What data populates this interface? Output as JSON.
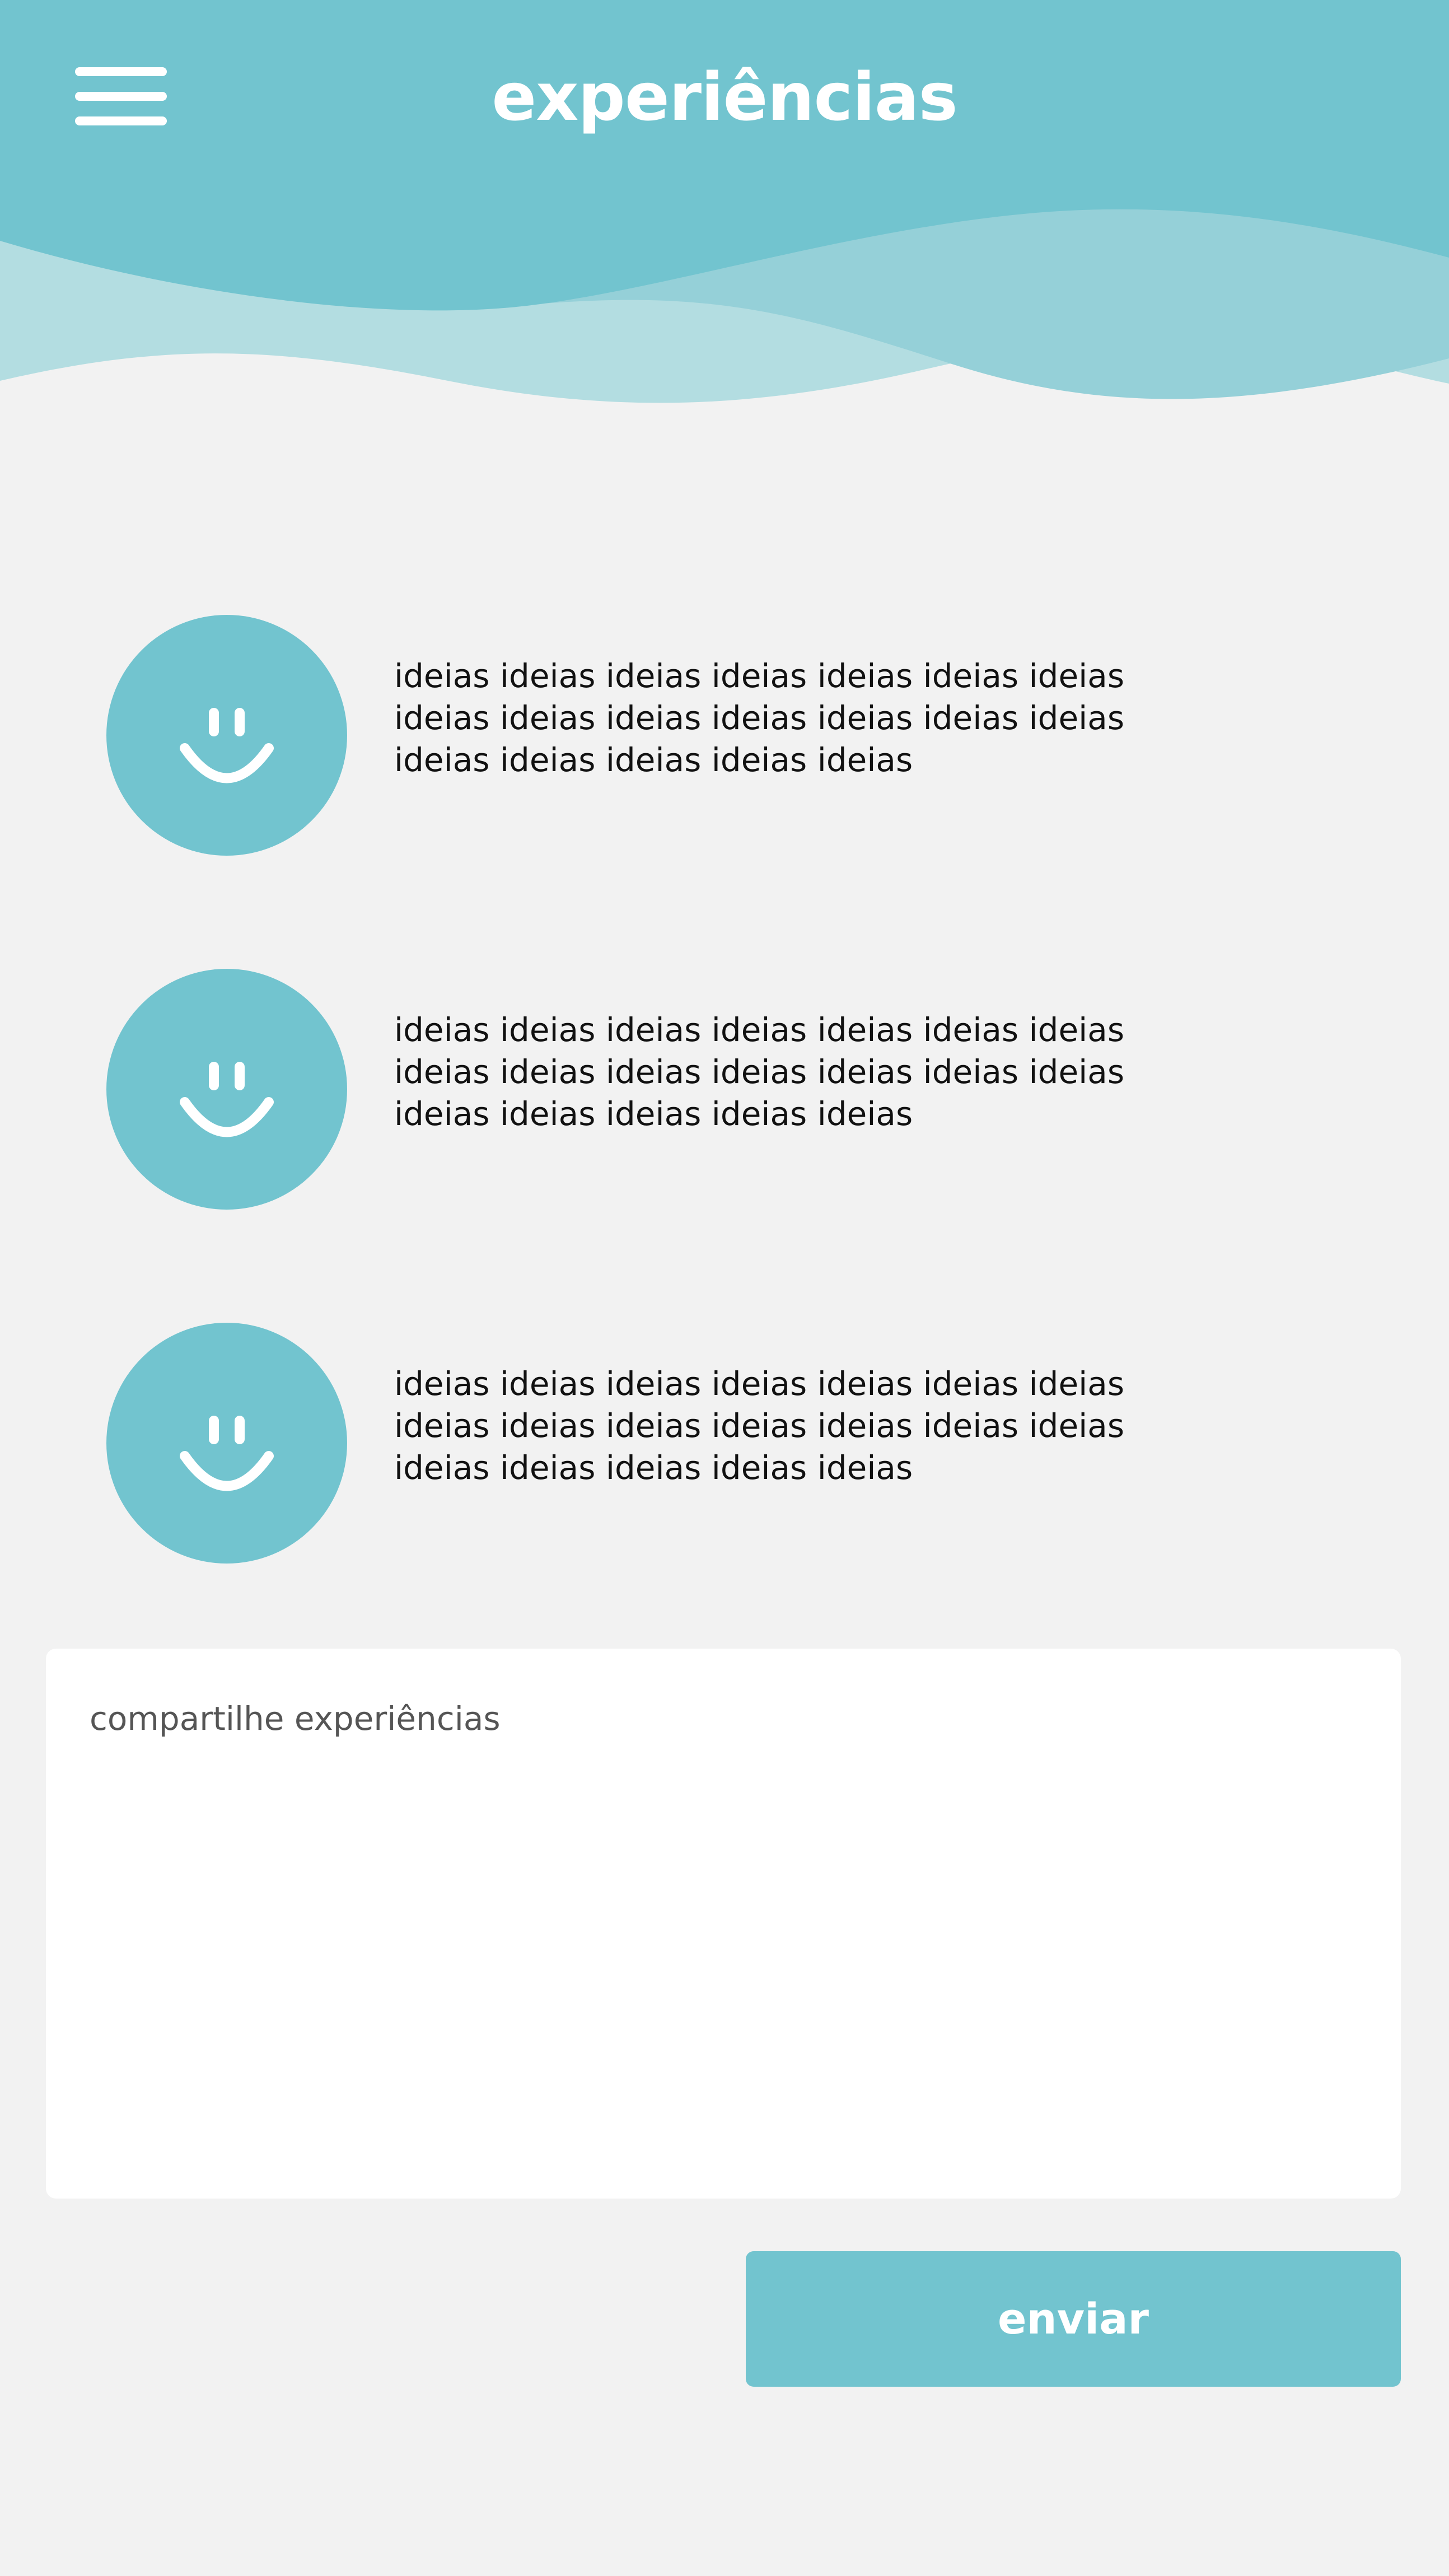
{
  "header": {
    "title": "experiências",
    "menu_icon": "hamburger-menu-icon",
    "colors": {
      "primary": "#72c4cf",
      "wave_mid": "#95d0d8",
      "wave_light": "#b3dde1"
    }
  },
  "feed": {
    "items": [
      {
        "avatar_icon": "smiley-face-icon",
        "text": "ideias ideias ideias ideias ideias ideias ideias ideias ideias ideias ideias ideias ideias ideias ideias ideias ideias ideias ideias"
      },
      {
        "avatar_icon": "smiley-face-icon",
        "text": "ideias ideias ideias ideias ideias ideias ideias ideias ideias ideias ideias ideias ideias ideias ideias ideias ideias ideias ideias"
      },
      {
        "avatar_icon": "smiley-face-icon",
        "text": "ideias ideias ideias ideias ideias ideias ideias ideias ideias ideias ideias ideias ideias ideias ideias ideias ideias ideias ideias"
      }
    ]
  },
  "composer": {
    "placeholder": "compartilhe experiências",
    "value": ""
  },
  "actions": {
    "send_label": "enviar"
  },
  "colors": {
    "background": "#f2f2f2",
    "accent": "#72c4cf",
    "text": "#111111"
  }
}
